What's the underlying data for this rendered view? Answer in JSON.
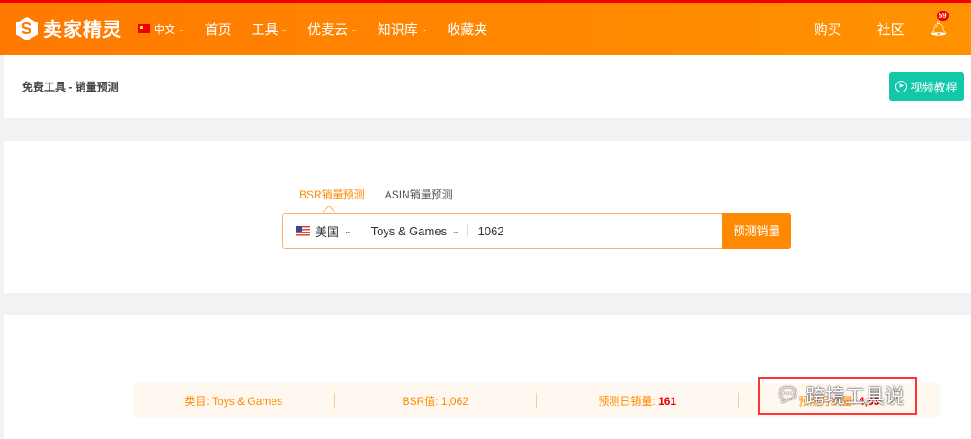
{
  "header": {
    "logo": "卖家精灵",
    "lang": "中文",
    "nav": [
      "首页",
      "工具",
      "优麦云",
      "知识库",
      "收藏夹"
    ],
    "right": [
      "购买",
      "社区"
    ],
    "notifications": "59"
  },
  "breadcrumb": "免费工具 - 销量预测",
  "video_button": "视频教程",
  "tabs": [
    "BSR销量预测",
    "ASIN销量预测"
  ],
  "search": {
    "country": "美国",
    "category": "Toys & Games",
    "bsr": "1062",
    "button": "预测销量"
  },
  "result": {
    "category_label": "类目: Toys & Games",
    "bsr_label": "BSR值: ",
    "bsr_value": "1,062",
    "daily_label": "预测日销量: ",
    "daily_value": "161",
    "monthly_label": "预测月销量: ",
    "monthly_value": "4,83"
  },
  "watermark": "跨境工具说"
}
